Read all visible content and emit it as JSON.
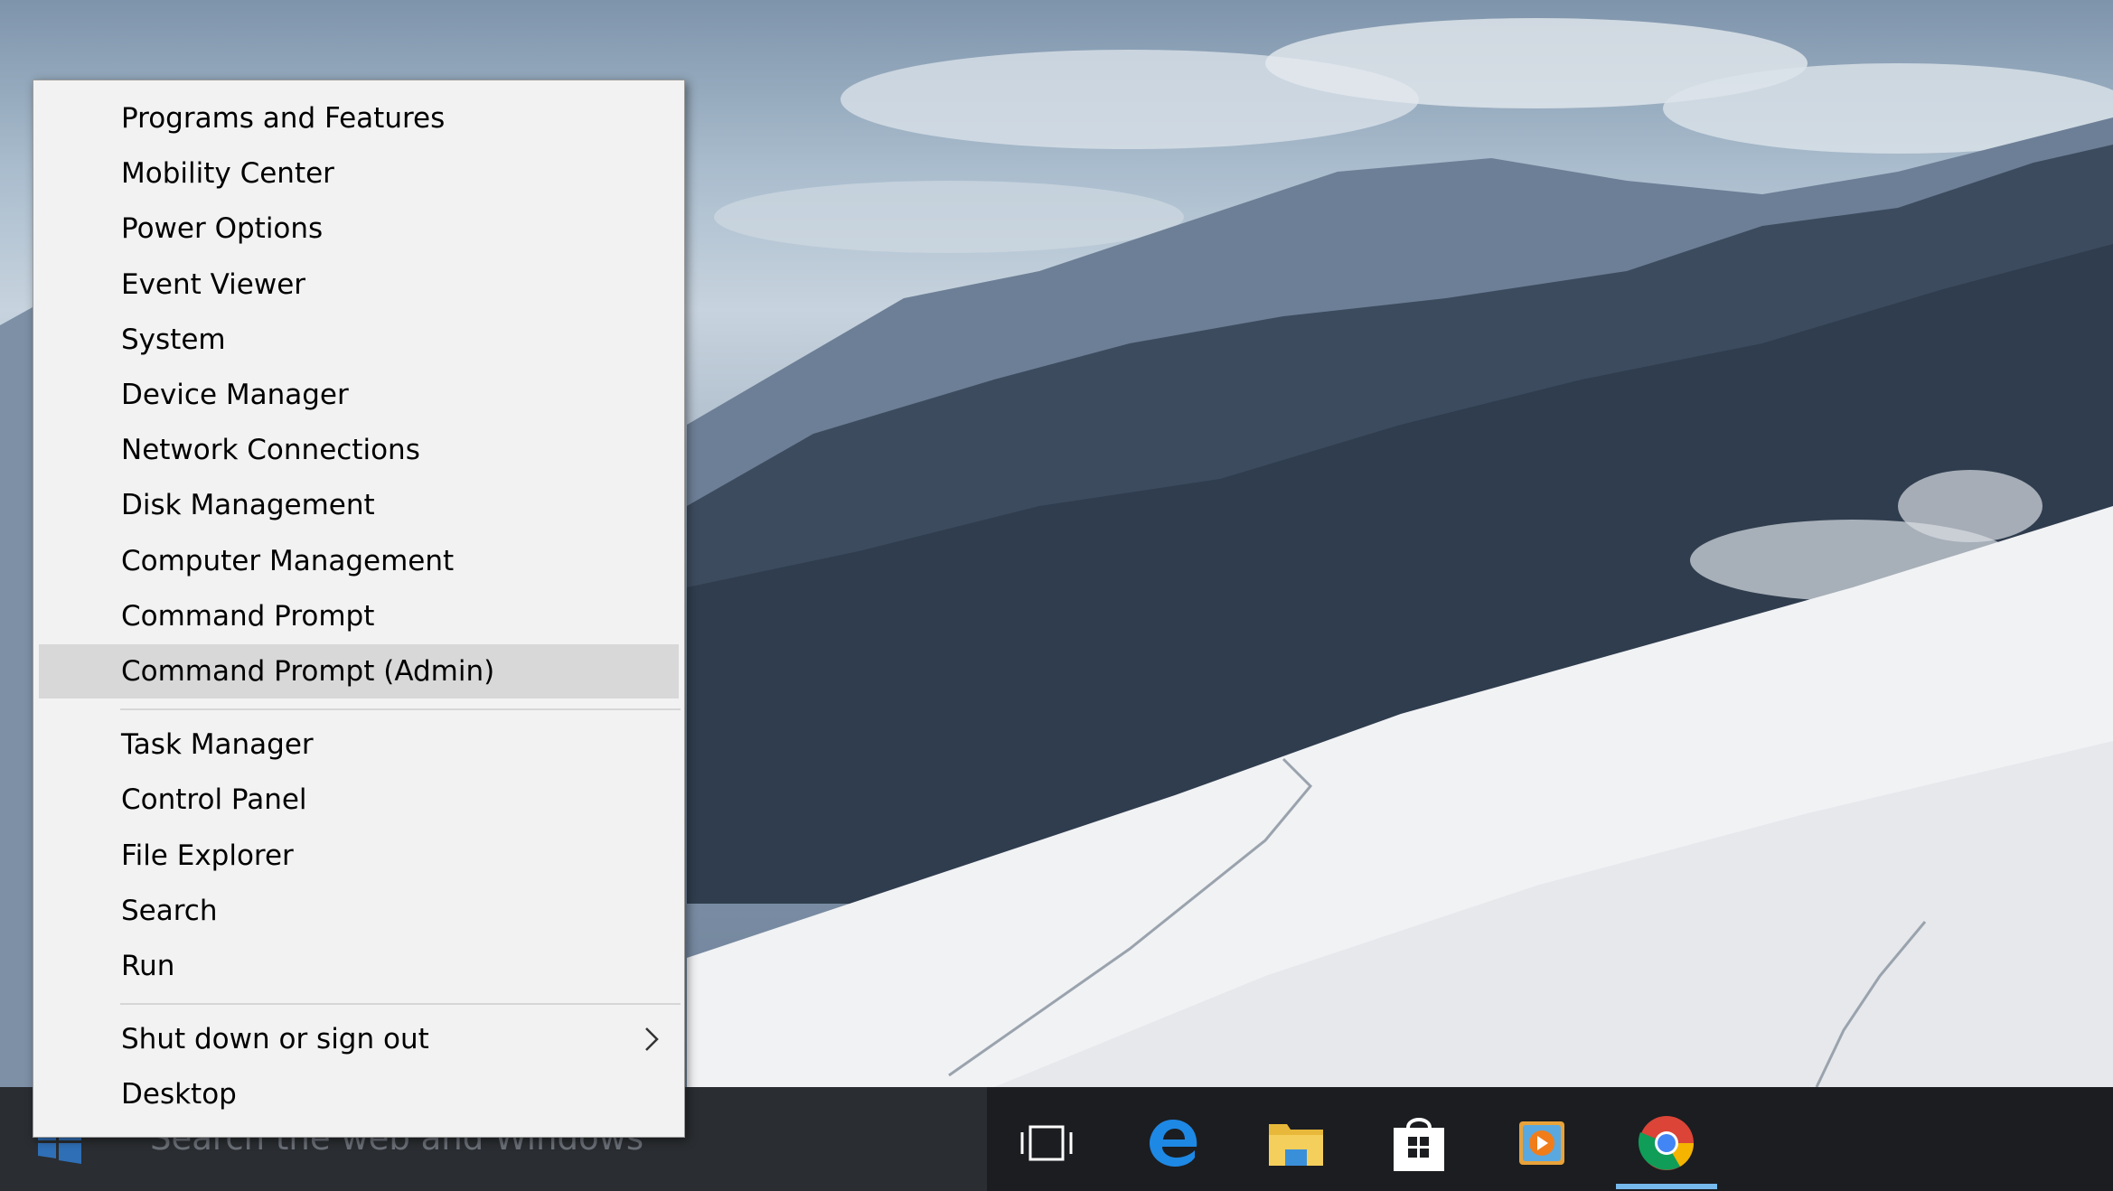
{
  "context_menu": {
    "group1": [
      "Programs and Features",
      "Mobility Center",
      "Power Options",
      "Event Viewer",
      "System",
      "Device Manager",
      "Network Connections",
      "Disk Management",
      "Computer Management",
      "Command Prompt",
      "Command Prompt (Admin)"
    ],
    "group2": [
      "Task Manager",
      "Control Panel",
      "File Explorer",
      "Search",
      "Run"
    ],
    "group3": [
      "Shut down or sign out",
      "Desktop"
    ],
    "highlighted_item": "Command Prompt (Admin)",
    "submenu_icon": "chevron-right-icon"
  },
  "taskbar": {
    "search_placeholder": "Search the web and Windows",
    "start_icon": "windows-logo-icon",
    "icons": [
      "task-view-icon",
      "edge-icon",
      "file-explorer-icon",
      "store-icon",
      "media-player-icon",
      "chrome-icon"
    ],
    "active_icon": "chrome-icon"
  },
  "colors": {
    "menu_bg": "#f2f2f2",
    "menu_highlight": "#d8d8d8",
    "taskbar_bg": "#1b1d20",
    "active_indicator": "#76b9ed"
  }
}
